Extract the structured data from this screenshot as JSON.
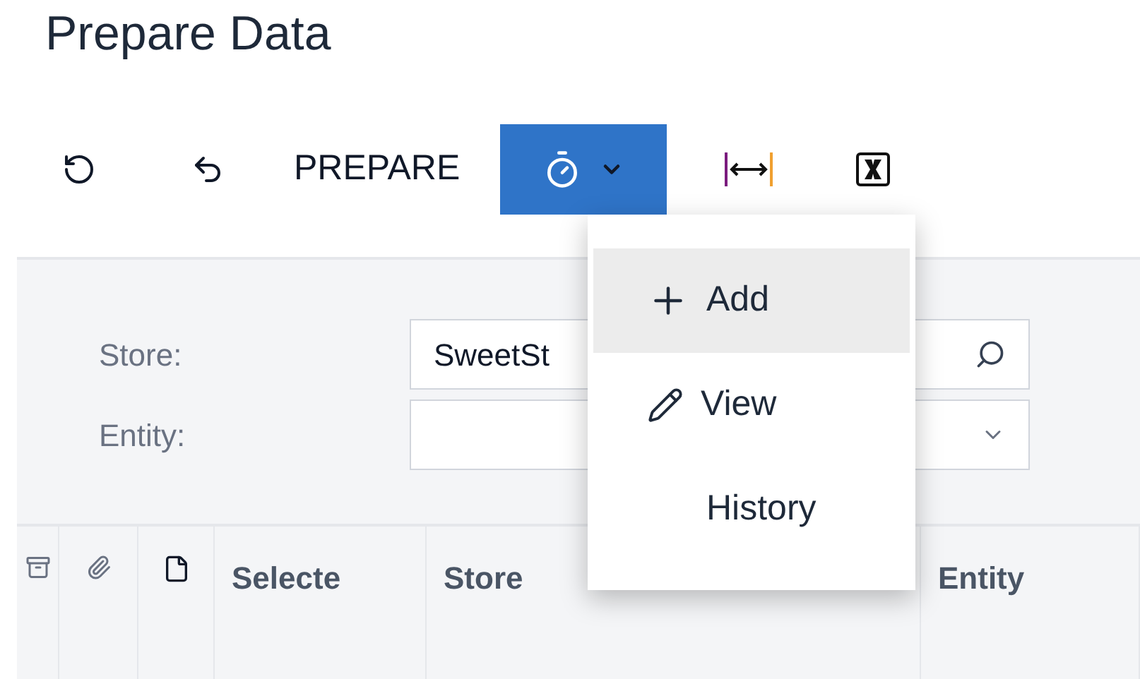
{
  "title": "Prepare Data",
  "toolbar": [
    {
      "kind": "refresh"
    },
    {
      "kind": "undo"
    },
    {
      "kind": "text",
      "label": "PREPARE"
    },
    {
      "kind": "menu",
      "open": true
    },
    {
      "kind": "fit"
    },
    {
      "kind": "excel"
    }
  ],
  "menu": [
    {
      "label": "Add",
      "kind": "plus",
      "selected": true
    },
    {
      "label": "View",
      "kind": "pencil",
      "selected": false
    },
    {
      "label": "History",
      "kind": "plain",
      "selected": false
    }
  ],
  "filters": [
    {
      "label": "Store:",
      "value": "SweetSt",
      "kind": "search"
    },
    {
      "label": "Entity:",
      "kind": "select"
    }
  ],
  "columns": [
    {
      "kind": "files-icon"
    },
    {
      "kind": "attach-icon"
    },
    {
      "kind": "note-icon"
    },
    {
      "kind": "text",
      "label": "Selecte"
    },
    {
      "kind": "text",
      "label": "Store"
    },
    {
      "kind": "text",
      "label": "Entity"
    }
  ]
}
